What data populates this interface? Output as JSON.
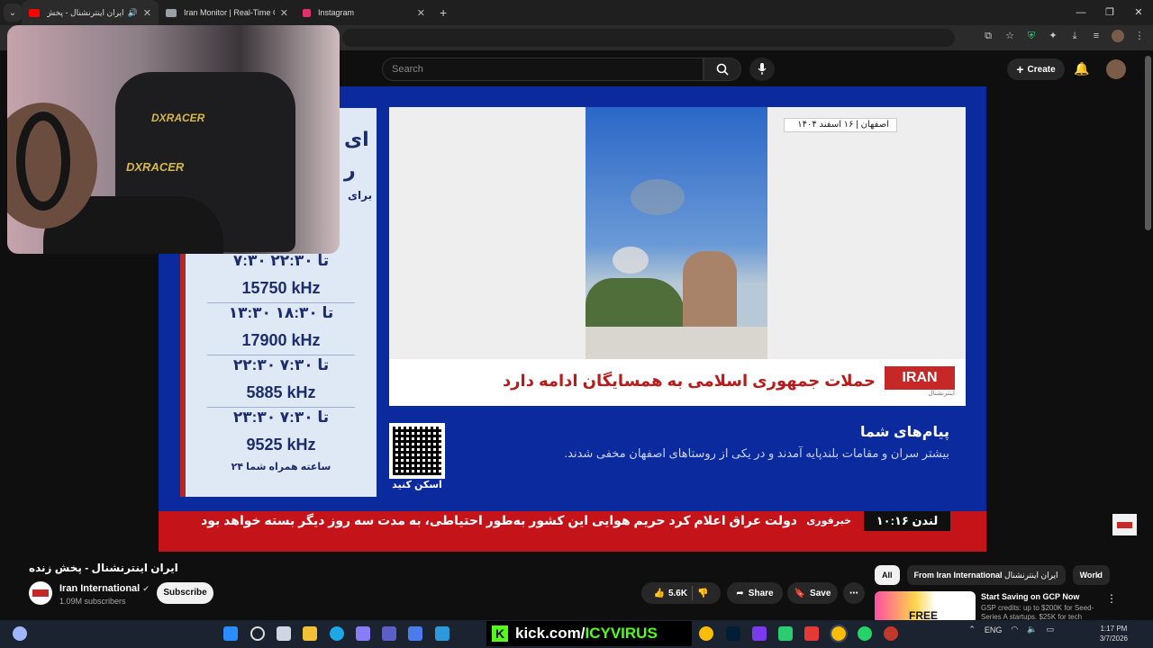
{
  "browser": {
    "tabs": [
      {
        "title": "ایران اینترنشنال - پخش زنده",
        "active": true,
        "favicon_color": "#ff0000"
      },
      {
        "title": "Iran Monitor | Real-Time OSINT",
        "active": false,
        "favicon_color": "#9aa0a6"
      },
      {
        "title": "Instagram",
        "active": false,
        "favicon_color": "#e1306c"
      }
    ]
  },
  "youtube": {
    "search_placeholder": "Search",
    "create_label": "Create"
  },
  "video": {
    "schedule": {
      "header1": "ای",
      "header2": "ر",
      "header3": "برای",
      "rows": [
        {
          "time": "۷:۳۰ تا ۲۲:۳۰",
          "freq": "15750 kHz"
        },
        {
          "time": "۱۳:۳۰ تا ۱۸:۳۰",
          "freq": "17900 kHz"
        },
        {
          "time": "۲۲:۳۰ تا ۷:۳۰",
          "freq": "5885 kHz"
        },
        {
          "time": "۲۳:۳۰ تا ۷:۳۰",
          "freq": "9525 kHz"
        }
      ],
      "note": "۲۴ ساعته همراه شما"
    },
    "location_tag": "اصفهان  |  ۱۶ اسفند ۱۴۰۴",
    "headline": "حملات جمهوری اسلامی به همسایگان ادامه دارد",
    "logo_text": "IRAN",
    "logo_sub": "اینترنشنال",
    "qr_label": "اسکن کنید",
    "messages_title": "پیام‌های شما",
    "messages_body": "بیشتر سران و مقامات بلندپایه آمدند و در یکی از روستاهای اصفهان مخفی شدند.",
    "ticker_clock": "لندن ۱۰:۱۶",
    "ticker_label": "خبرفوری",
    "ticker_text": "دولت عراق اعلام کرد حریم هوایی این کشور به‌طور احتیاطی، به مدت سه روز دیگر بسته خواهد بود"
  },
  "webcam": {
    "brand_1": "DXRACER",
    "brand_2": "DXRACER"
  },
  "watch": {
    "title": "ایران اینترنشنال - پخش زنده",
    "channel_name": "Iran International",
    "subscribers": "1.09M subscribers",
    "subscribe_label": "Subscribe",
    "likes": "5.6K",
    "share_label": "Share",
    "save_label": "Save"
  },
  "sidebar": {
    "chips": [
      "All",
      "From Iran International",
      "ایران اینترنشنال",
      "World"
    ],
    "ad_title": "Start Saving on GCP Now",
    "ad_sub": "GSP credits: up to $200K for Seed-Series A startups. $25K for tech",
    "ad_thumb_text": "FREE"
  },
  "taskbar": {
    "kick_label": "kick.com/",
    "kick_user": "ICYVIRUS",
    "language": "ENG",
    "time": "1:17 PM",
    "date": "3/7/2026"
  }
}
